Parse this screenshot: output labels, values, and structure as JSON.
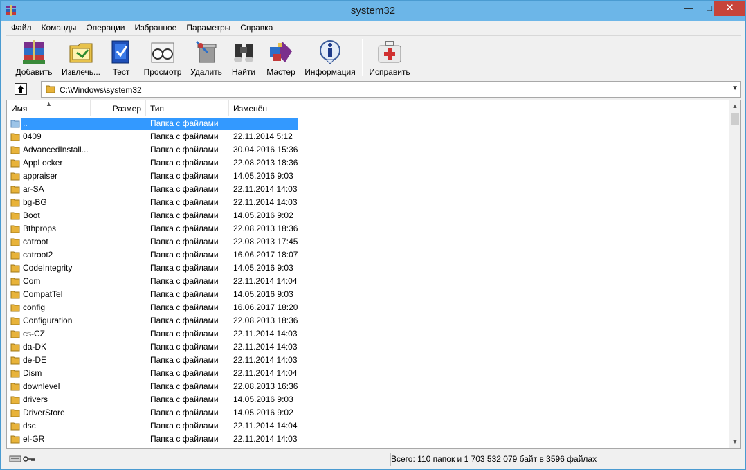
{
  "window": {
    "title": "system32"
  },
  "menu": [
    "Файл",
    "Команды",
    "Операции",
    "Избранное",
    "Параметры",
    "Справка"
  ],
  "toolbar": [
    {
      "label": "Добавить",
      "icon": "archive-books-icon"
    },
    {
      "label": "Извлечь...",
      "icon": "extract-folder-icon"
    },
    {
      "label": "Тест",
      "icon": "test-book-icon"
    },
    {
      "label": "Просмотр",
      "icon": "glasses-icon"
    },
    {
      "label": "Удалить",
      "icon": "delete-icon"
    },
    {
      "label": "Найти",
      "icon": "binoculars-icon"
    },
    {
      "label": "Мастер",
      "icon": "wizard-icon"
    },
    {
      "label": "Информация",
      "icon": "info-icon"
    },
    {
      "label": "Исправить",
      "icon": "first-aid-kit-icon"
    }
  ],
  "address": {
    "path": "C:\\Windows\\system32"
  },
  "columns": {
    "name": "Имя",
    "size": "Размер",
    "type": "Тип",
    "modified": "Изменён"
  },
  "rows": [
    {
      "name": "..",
      "type": "Папка с файлами",
      "modified": "",
      "selected": true
    },
    {
      "name": "0409",
      "type": "Папка с файлами",
      "modified": "22.11.2014 5:12"
    },
    {
      "name": "AdvancedInstall...",
      "type": "Папка с файлами",
      "modified": "30.04.2016 15:36"
    },
    {
      "name": "AppLocker",
      "type": "Папка с файлами",
      "modified": "22.08.2013 18:36"
    },
    {
      "name": "appraiser",
      "type": "Папка с файлами",
      "modified": "14.05.2016 9:03"
    },
    {
      "name": "ar-SA",
      "type": "Папка с файлами",
      "modified": "22.11.2014 14:03"
    },
    {
      "name": "bg-BG",
      "type": "Папка с файлами",
      "modified": "22.11.2014 14:03"
    },
    {
      "name": "Boot",
      "type": "Папка с файлами",
      "modified": "14.05.2016 9:02"
    },
    {
      "name": "Bthprops",
      "type": "Папка с файлами",
      "modified": "22.08.2013 18:36"
    },
    {
      "name": "catroot",
      "type": "Папка с файлами",
      "modified": "22.08.2013 17:45"
    },
    {
      "name": "catroot2",
      "type": "Папка с файлами",
      "modified": "16.06.2017 18:07"
    },
    {
      "name": "CodeIntegrity",
      "type": "Папка с файлами",
      "modified": "14.05.2016 9:03"
    },
    {
      "name": "Com",
      "type": "Папка с файлами",
      "modified": "22.11.2014 14:04"
    },
    {
      "name": "CompatTel",
      "type": "Папка с файлами",
      "modified": "14.05.2016 9:03"
    },
    {
      "name": "config",
      "type": "Папка с файлами",
      "modified": "16.06.2017 18:20"
    },
    {
      "name": "Configuration",
      "type": "Папка с файлами",
      "modified": "22.08.2013 18:36"
    },
    {
      "name": "cs-CZ",
      "type": "Папка с файлами",
      "modified": "22.11.2014 14:03"
    },
    {
      "name": "da-DK",
      "type": "Папка с файлами",
      "modified": "22.11.2014 14:03"
    },
    {
      "name": "de-DE",
      "type": "Папка с файлами",
      "modified": "22.11.2014 14:03"
    },
    {
      "name": "Dism",
      "type": "Папка с файлами",
      "modified": "22.11.2014 14:04"
    },
    {
      "name": "downlevel",
      "type": "Папка с файлами",
      "modified": "22.08.2013 16:36"
    },
    {
      "name": "drivers",
      "type": "Папка с файлами",
      "modified": "14.05.2016 9:03"
    },
    {
      "name": "DriverStore",
      "type": "Папка с файлами",
      "modified": "14.05.2016 9:02"
    },
    {
      "name": "dsc",
      "type": "Папка с файлами",
      "modified": "22.11.2014 14:04"
    },
    {
      "name": "el-GR",
      "type": "Папка с файлами",
      "modified": "22.11.2014 14:03"
    }
  ],
  "status": {
    "summary": "Всего: 110 папок и 1 703 532 079 байт в 3596 файлах"
  },
  "colors": {
    "titlebar": "#6cb6e8",
    "selection": "#3399ff",
    "close": "#c7443a",
    "folder": "#e8b33a"
  }
}
